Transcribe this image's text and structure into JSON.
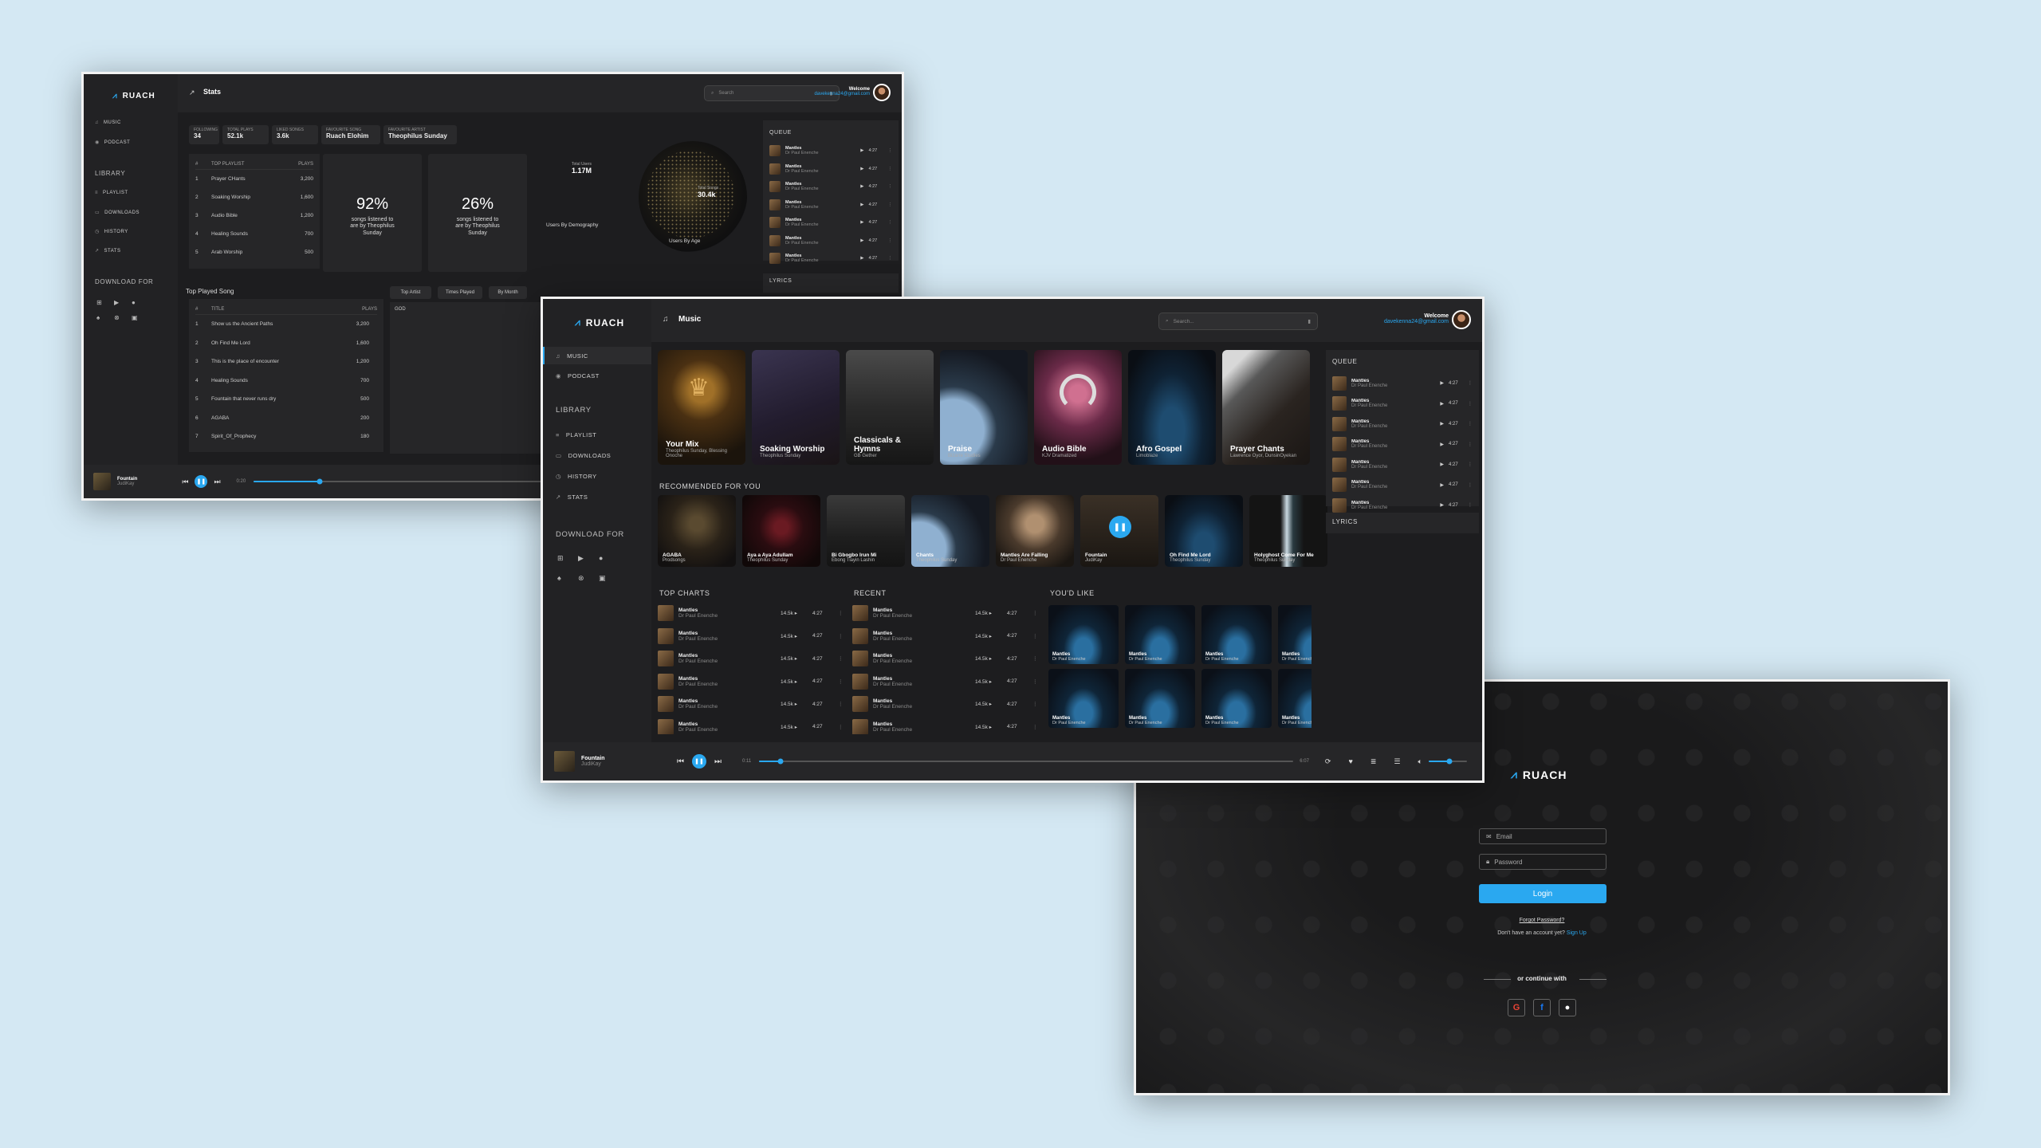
{
  "stats_window": {
    "brand": "RUACH",
    "nav": [
      "MUSIC",
      "PODCAST"
    ],
    "library_title": "LIBRARY",
    "library": [
      "PLAYLIST",
      "DOWNLOADS",
      "HISTORY",
      "STATS"
    ],
    "download_title": "DOWNLOAD FOR",
    "page_title": "Stats",
    "search_placeholder": "Search",
    "welcome": "Welcome",
    "email": "davekenna24@gmail.com",
    "chips": [
      {
        "label": "FOLLOWING",
        "value": "34"
      },
      {
        "label": "TOTAL PLAYS",
        "value": "52.1k"
      },
      {
        "label": "LIKED SONGS",
        "value": "3.6k"
      },
      {
        "label": "FAVOURITE SONG",
        "value": "Ruach Elohim"
      },
      {
        "label": "FAVOURITE ARTIST",
        "value": "Theophilus Sunday"
      }
    ],
    "playlist_table": {
      "h1": "#",
      "h2": "TOP PLAYLIST",
      "h3": "PLAYS",
      "rows": [
        [
          "1",
          "Prayer CHants",
          "3,200"
        ],
        [
          "2",
          "Soaking Worship",
          "1,600"
        ],
        [
          "3",
          "Audio Bible",
          "1,200"
        ],
        [
          "4",
          "Healing Sounds",
          "700"
        ],
        [
          "5",
          "Arab Worship",
          "500"
        ]
      ]
    },
    "pct1": {
      "value": "92%",
      "label": "songs listened to are by Theophilus Sunday"
    },
    "pct2": {
      "value": "26%",
      "label": "songs listened to are by Theophilus Sunday"
    },
    "globe": {
      "total_users_label": "Total Users",
      "total_users": "1.17M",
      "total_songs_label": "Total Songs",
      "total_songs": "30.4k",
      "by_demo": "Users By Demography",
      "by_age": "Users By Age"
    },
    "top_song_title": "Top Played Song",
    "song_table": {
      "h1": "#",
      "h2": "TITLE",
      "h3": "PLAYS",
      "rows": [
        [
          "1",
          "Show us the Ancient Paths",
          "3,200"
        ],
        [
          "2",
          "Oh Find Me Lord",
          "1,600"
        ],
        [
          "3",
          "This is the place of encounter",
          "1,200"
        ],
        [
          "4",
          "Healing Sounds",
          "700"
        ],
        [
          "5",
          "Fountain that never runs dry",
          "500"
        ],
        [
          "6",
          "AGABA",
          "200"
        ],
        [
          "7",
          "Spirit_Of_Prophecy",
          "180"
        ]
      ]
    },
    "tabs": [
      "Top Artist",
      "Times Played",
      "By Month"
    ],
    "tab_content": "GOD",
    "queue_title": "QUEUE",
    "lyrics_title": "LYRICS",
    "player": {
      "title": "Fountain",
      "artist": "JudiKay",
      "time": "0:20",
      "progress": 0.16
    }
  },
  "music_window": {
    "brand": "RUACH",
    "nav": [
      "MUSIC",
      "PODCAST"
    ],
    "library_title": "LIBRARY",
    "library": [
      "PLAYLIST",
      "DOWNLOADS",
      "HISTORY",
      "STATS"
    ],
    "download_title": "DOWNLOAD FOR",
    "page_title": "Music",
    "search_placeholder": "Search...",
    "welcome": "Welcome",
    "email": "davekenna24@gmail.com",
    "cards": [
      {
        "title": "Your Mix",
        "sub": "Theophilus Sunday, Blessing Onoche"
      },
      {
        "title": "Soaking Worship",
        "sub": "Theophilus Sunday"
      },
      {
        "title": "Classicals & Hymns",
        "sub": "GB Gether"
      },
      {
        "title": "Praise",
        "sub": "Bizarre Studies"
      },
      {
        "title": "Audio Bible",
        "sub": "KJV Dramatized"
      },
      {
        "title": "Afro Gospel",
        "sub": "Limoblaze"
      },
      {
        "title": "Prayer Chants",
        "sub": "Lawrence Oyor, DunsinOyekan"
      }
    ],
    "rec_title": "RECOMMENDED FOR YOU",
    "recs": [
      {
        "title": "AGABA",
        "sub": "Prodsongs"
      },
      {
        "title": "Aya a Aya Adullam",
        "sub": "Theophilus Sunday"
      },
      {
        "title": "Bi Gbogbo Irun Mi",
        "sub": "Ebong Tiayin Lashin"
      },
      {
        "title": "Chants",
        "sub": "Theophilus Sunday"
      },
      {
        "title": "Mantles Are Falling",
        "sub": "Dr Paul Enenche"
      },
      {
        "title": "Fountain",
        "sub": "JudiKay"
      },
      {
        "title": "Oh Find Me Lord",
        "sub": "Theophilus Sunday"
      },
      {
        "title": "Holyghost Come For Me",
        "sub": "Theophilus Sunday"
      }
    ],
    "top_charts_title": "TOP CHARTS",
    "recent_title": "RECENT",
    "youd_like_title": "YOU'D LIKE",
    "list_row": {
      "title": "Mantles",
      "artist": "Dr Paul Enenche",
      "plays": "14.5k ▸",
      "dur": "4:27"
    },
    "youd_like": {
      "title": "Mantles",
      "artist": "Dr Paul Enenche"
    },
    "queue_title": "QUEUE",
    "queue_row": {
      "title": "Mantles",
      "artist": "Dr Paul Enenche",
      "dur": "4:27"
    },
    "lyrics_title": "LYRICS",
    "player": {
      "title": "Fountain",
      "artist": "JudiKay",
      "time_start": "0:11",
      "time_end": "6:07",
      "progress": 0.04,
      "volume": 0.55
    }
  },
  "login_window": {
    "brand": "RUACH",
    "email_placeholder": "Email",
    "password_placeholder": "Password",
    "login_label": "Login",
    "forgot": "Forgot Password?",
    "no_account": "Don't have an account yet?",
    "signup": "Sign Up",
    "continue": "or continue with"
  },
  "colors": {
    "accent": "#2aa8f0",
    "bg": "#1d1d1f",
    "page": "#d4e8f3"
  }
}
